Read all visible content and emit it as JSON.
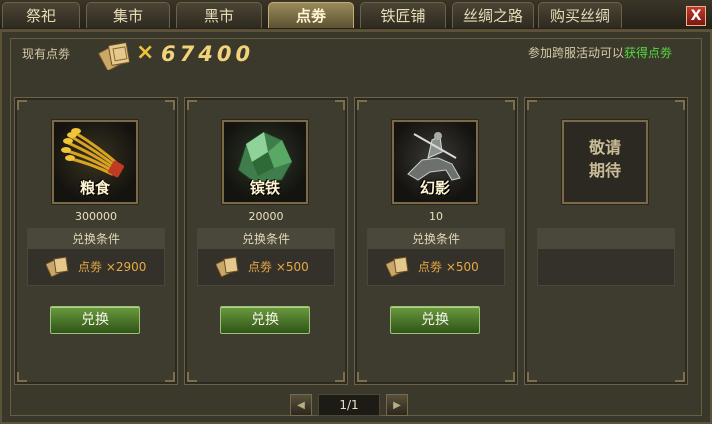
{
  "tabs": [
    {
      "label": "祭祀",
      "active": false
    },
    {
      "label": "集市",
      "active": false
    },
    {
      "label": "黑市",
      "active": false
    },
    {
      "label": "点劵",
      "active": true
    },
    {
      "label": "铁匠铺",
      "active": false
    },
    {
      "label": "丝绸之路",
      "active": false
    },
    {
      "label": "购买丝绸",
      "active": false
    }
  ],
  "close_label": "X",
  "points": {
    "label": "现有点劵",
    "times": "×",
    "value": "67400"
  },
  "event_note": {
    "prefix": "参加跨服活动可以",
    "highlight": "获得点劵"
  },
  "cards": [
    {
      "name": "粮食",
      "quantity": "300000",
      "condition_title": "兑换条件",
      "cost": "点劵 ×2900",
      "button": "兑换",
      "icon": "grain-icon"
    },
    {
      "name": "镔铁",
      "quantity": "20000",
      "condition_title": "兑换条件",
      "cost": "点劵 ×500",
      "button": "兑换",
      "icon": "iron-ore-icon"
    },
    {
      "name": "幻影",
      "quantity": "10",
      "condition_title": "兑换条件",
      "cost": "点劵 ×500",
      "button": "兑换",
      "icon": "phantom-rider-icon"
    },
    {
      "placeholder": "敬请\n期待"
    }
  ],
  "pagination": {
    "current": "1/1",
    "prev_icon": "arrow-left-icon",
    "next_icon": "arrow-right-icon"
  },
  "colors": {
    "accent_gold": "#f2d27a",
    "highlight_green": "#56d943",
    "button_green": "#4d7a2b",
    "close_red": "#c53a2c"
  }
}
